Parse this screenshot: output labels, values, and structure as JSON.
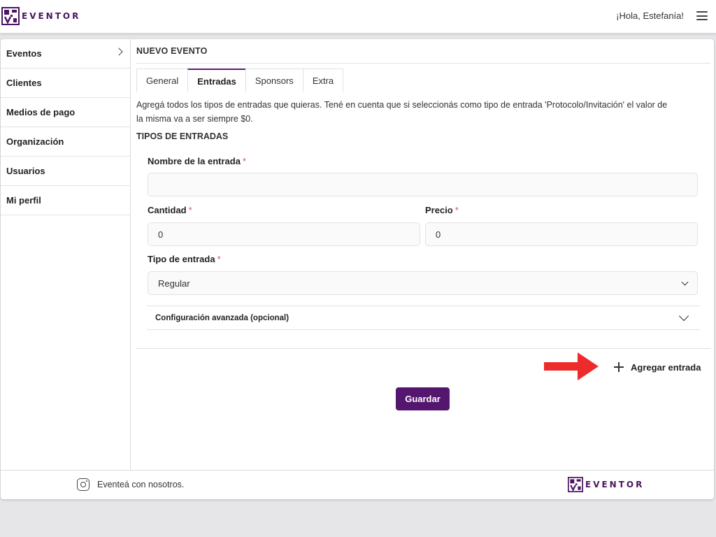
{
  "header": {
    "logo_text": "EVENTOR",
    "greeting": "¡Hola, Estefanía!",
    "menu_icon": "hamburger-menu-icon"
  },
  "sidebar": {
    "items": [
      {
        "label": "Eventos",
        "icon": "chevron-right-icon"
      },
      {
        "label": "Clientes"
      },
      {
        "label": "Medios de pago"
      },
      {
        "label": "Organización"
      },
      {
        "label": "Usuarios"
      },
      {
        "label": "Mi perfil"
      }
    ]
  },
  "main": {
    "title": "NUEVO EVENTO",
    "tabs": [
      {
        "label": "General"
      },
      {
        "label": "Entradas",
        "active": true
      },
      {
        "label": "Sponsors"
      },
      {
        "label": "Extra"
      }
    ],
    "description_line1": "Agregá todos los tipos de entradas que quieras. Tené en cuenta que si seleccionás como tipo de entrada 'Protocolo/Invitación' el valor de",
    "description_line2": "la misma va a ser siempre $0.",
    "section_title": "TIPOS DE ENTRADAS",
    "form": {
      "name_label": "Nombre de la entrada",
      "name_value": "",
      "quantity_label": "Cantidad",
      "quantity_value": "0",
      "price_label": "Precio",
      "price_value": "0",
      "type_label": "Tipo de entrada",
      "type_value": "Regular",
      "required_mark": "*"
    },
    "advanced_label": "Configuración avanzada (opcional)",
    "add_ticket_label": "Agregar entrada",
    "save_label": "Guardar"
  },
  "footer": {
    "text": "Eventeá con nosotros.",
    "logo_text": "EVENTOR",
    "social_icon": "instagram-icon"
  },
  "colors": {
    "brand": "#54166e",
    "required": "#d9534f",
    "annotation_arrow": "#ee2b2b"
  }
}
